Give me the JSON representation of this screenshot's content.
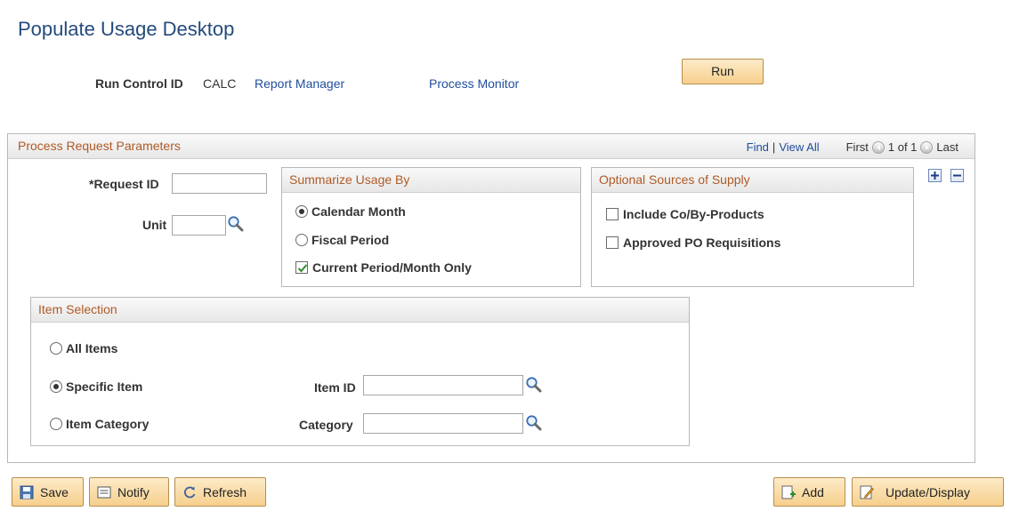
{
  "page": {
    "title": "Populate Usage Desktop"
  },
  "header": {
    "run_control_label": "Run Control ID",
    "run_control_value": "CALC",
    "report_manager": "Report Manager",
    "process_monitor": "Process Monitor",
    "run_button": "Run"
  },
  "params": {
    "title": "Process Request Parameters",
    "find": "Find",
    "separator": "|",
    "view_all": "View All",
    "first": "First",
    "count": "1 of 1",
    "last": "Last",
    "request_id_label": "*Request ID",
    "request_id_value": "",
    "unit_label": "Unit",
    "unit_value": ""
  },
  "summarize": {
    "title": "Summarize Usage By",
    "calendar_month": "Calendar Month",
    "fiscal_period": "Fiscal Period",
    "current_only": "Current Period/Month Only",
    "selected": "calendar_month",
    "current_only_checked": true
  },
  "optional": {
    "title": "Optional Sources of Supply",
    "include_coby": "Include Co/By-Products",
    "approved_po": "Approved PO Requisitions",
    "include_coby_checked": false,
    "approved_po_checked": false
  },
  "item_selection": {
    "title": "Item Selection",
    "all_items": "All Items",
    "specific_item": "Specific Item",
    "item_category": "Item Category",
    "selected": "specific_item",
    "item_id_label": "Item ID",
    "item_id_value": "",
    "category_label": "Category",
    "category_value": ""
  },
  "toolbar": {
    "save": "Save",
    "notify": "Notify",
    "refresh": "Refresh",
    "add": "Add",
    "update_display": "Update/Display"
  },
  "icons": {
    "lookup": "magnifier-icon",
    "add_row": "plus-icon",
    "delete_row": "minus-icon"
  },
  "colors": {
    "title": "#244a7c",
    "link": "#1f4e9c",
    "group_header_text": "#b05a25",
    "button_bg": "#f6cf8c"
  }
}
